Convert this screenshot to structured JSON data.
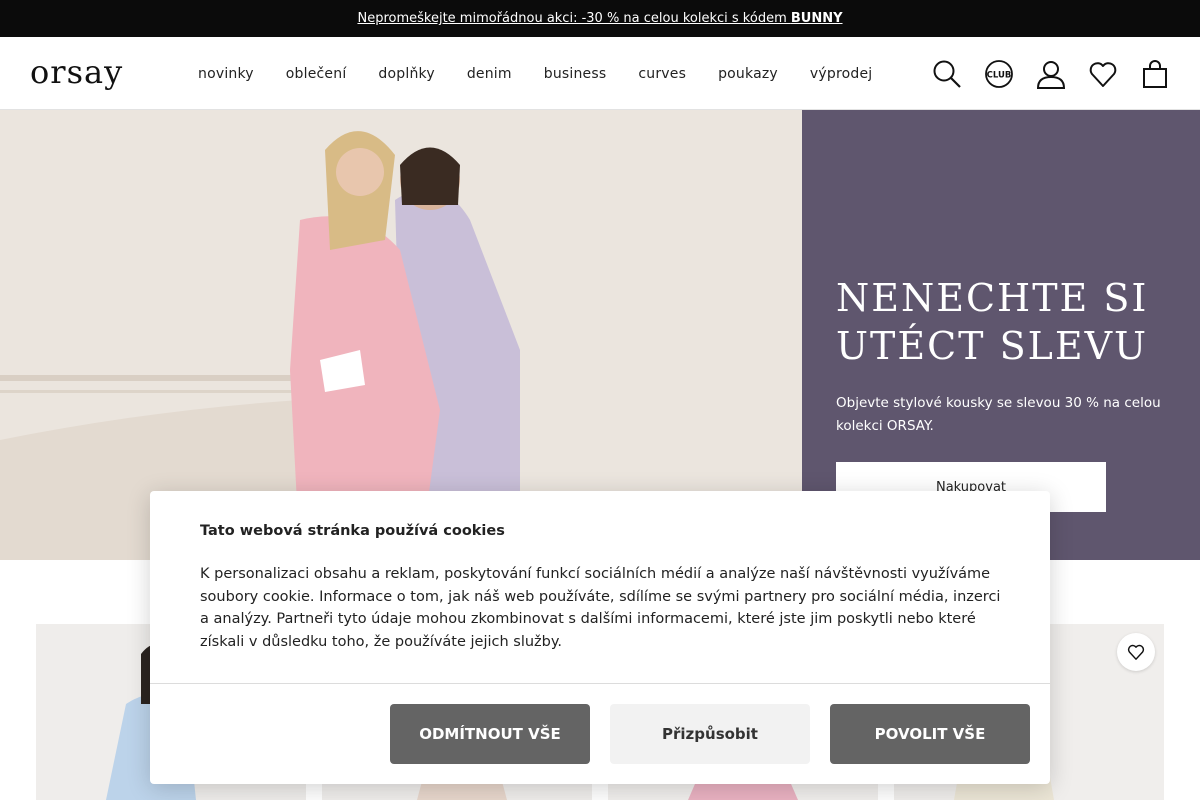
{
  "promo": {
    "text": "Nepromeškejte mimořádnou akci: -30 % na celou kolekci s kódem ",
    "code": "BUNNY"
  },
  "header": {
    "logo": "orsay",
    "nav": [
      "novinky",
      "oblečení",
      "doplňky",
      "denim",
      "business",
      "curves",
      "poukazy",
      "výprodej"
    ],
    "icons": [
      "search-icon",
      "club-icon",
      "account-icon",
      "wishlist-icon",
      "bag-icon"
    ],
    "club_label": "CLUB"
  },
  "hero": {
    "title": "NENECHTE SI UTÉCT SLEVU",
    "text": "Objevte stylové kousky se slevou 30 % na celou kolekci ORSAY.",
    "button": "Nakupovat",
    "panel_color": "#5f566e"
  },
  "cookie": {
    "title": "Tato webová stránka používá cookies",
    "text": "K personalizaci obsahu a reklam, poskytování funkcí sociálních médií a analýze naší návštěvnosti využíváme soubory cookie. Informace o tom, jak náš web používáte, sdílíme se svými partnery pro sociální média, inzerci a analýzy. Partneři tyto údaje mohou zkombinovat s dalšími informacemi, které jste jim poskytli nebo které získali v důsledku toho, že používáte jejich služby.",
    "reject": "ODMÍTNOUT VŠE",
    "customize": "Přizpůsobit",
    "accept": "POVOLIT VŠE"
  },
  "colors": {
    "promo_bg": "#0b0b0b",
    "button_dark": "#646464"
  }
}
